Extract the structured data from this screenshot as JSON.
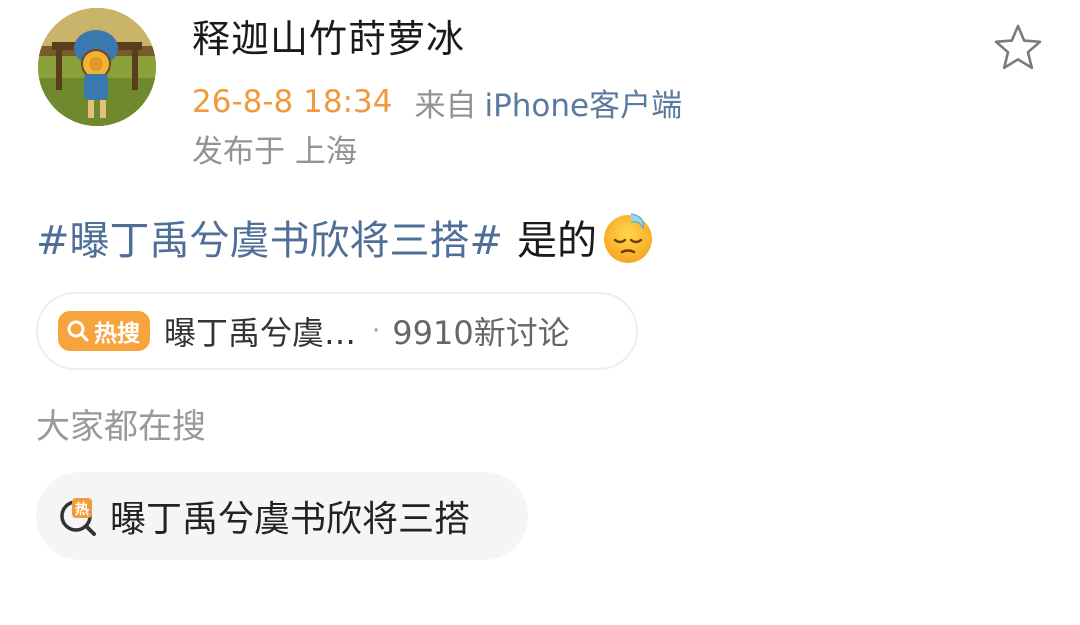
{
  "post": {
    "author": {
      "name": "释迦山竹莳萝冰",
      "avatar_icon": "cartoon-girl-avatar-icon"
    },
    "timestamp": "26-8-8 18:34",
    "source_prefix": "来自",
    "source_client": "iPhone客户端",
    "location": "发布于 上海",
    "favorite_icon": "star-outline-icon",
    "hashtag": "#曝丁禹兮虞书欣将三搭#",
    "text": "是的",
    "emoji": "sweat-smile-emoji-icon"
  },
  "hot_search": {
    "badge_label": "热搜",
    "badge_icon": "search-icon",
    "title": "曝丁禹兮虞…",
    "separator": "·",
    "count_text": "9910新讨论"
  },
  "everyone_search": {
    "label": "大家都在搜",
    "chip_icon": "hot-search-icon",
    "chip_text": "曝丁禹兮虞书欣将三搭"
  },
  "colors": {
    "time": "#f09a3c",
    "link": "#4f6f99",
    "meta_gray": "#939393",
    "hot_badge": "#f7a33e"
  }
}
